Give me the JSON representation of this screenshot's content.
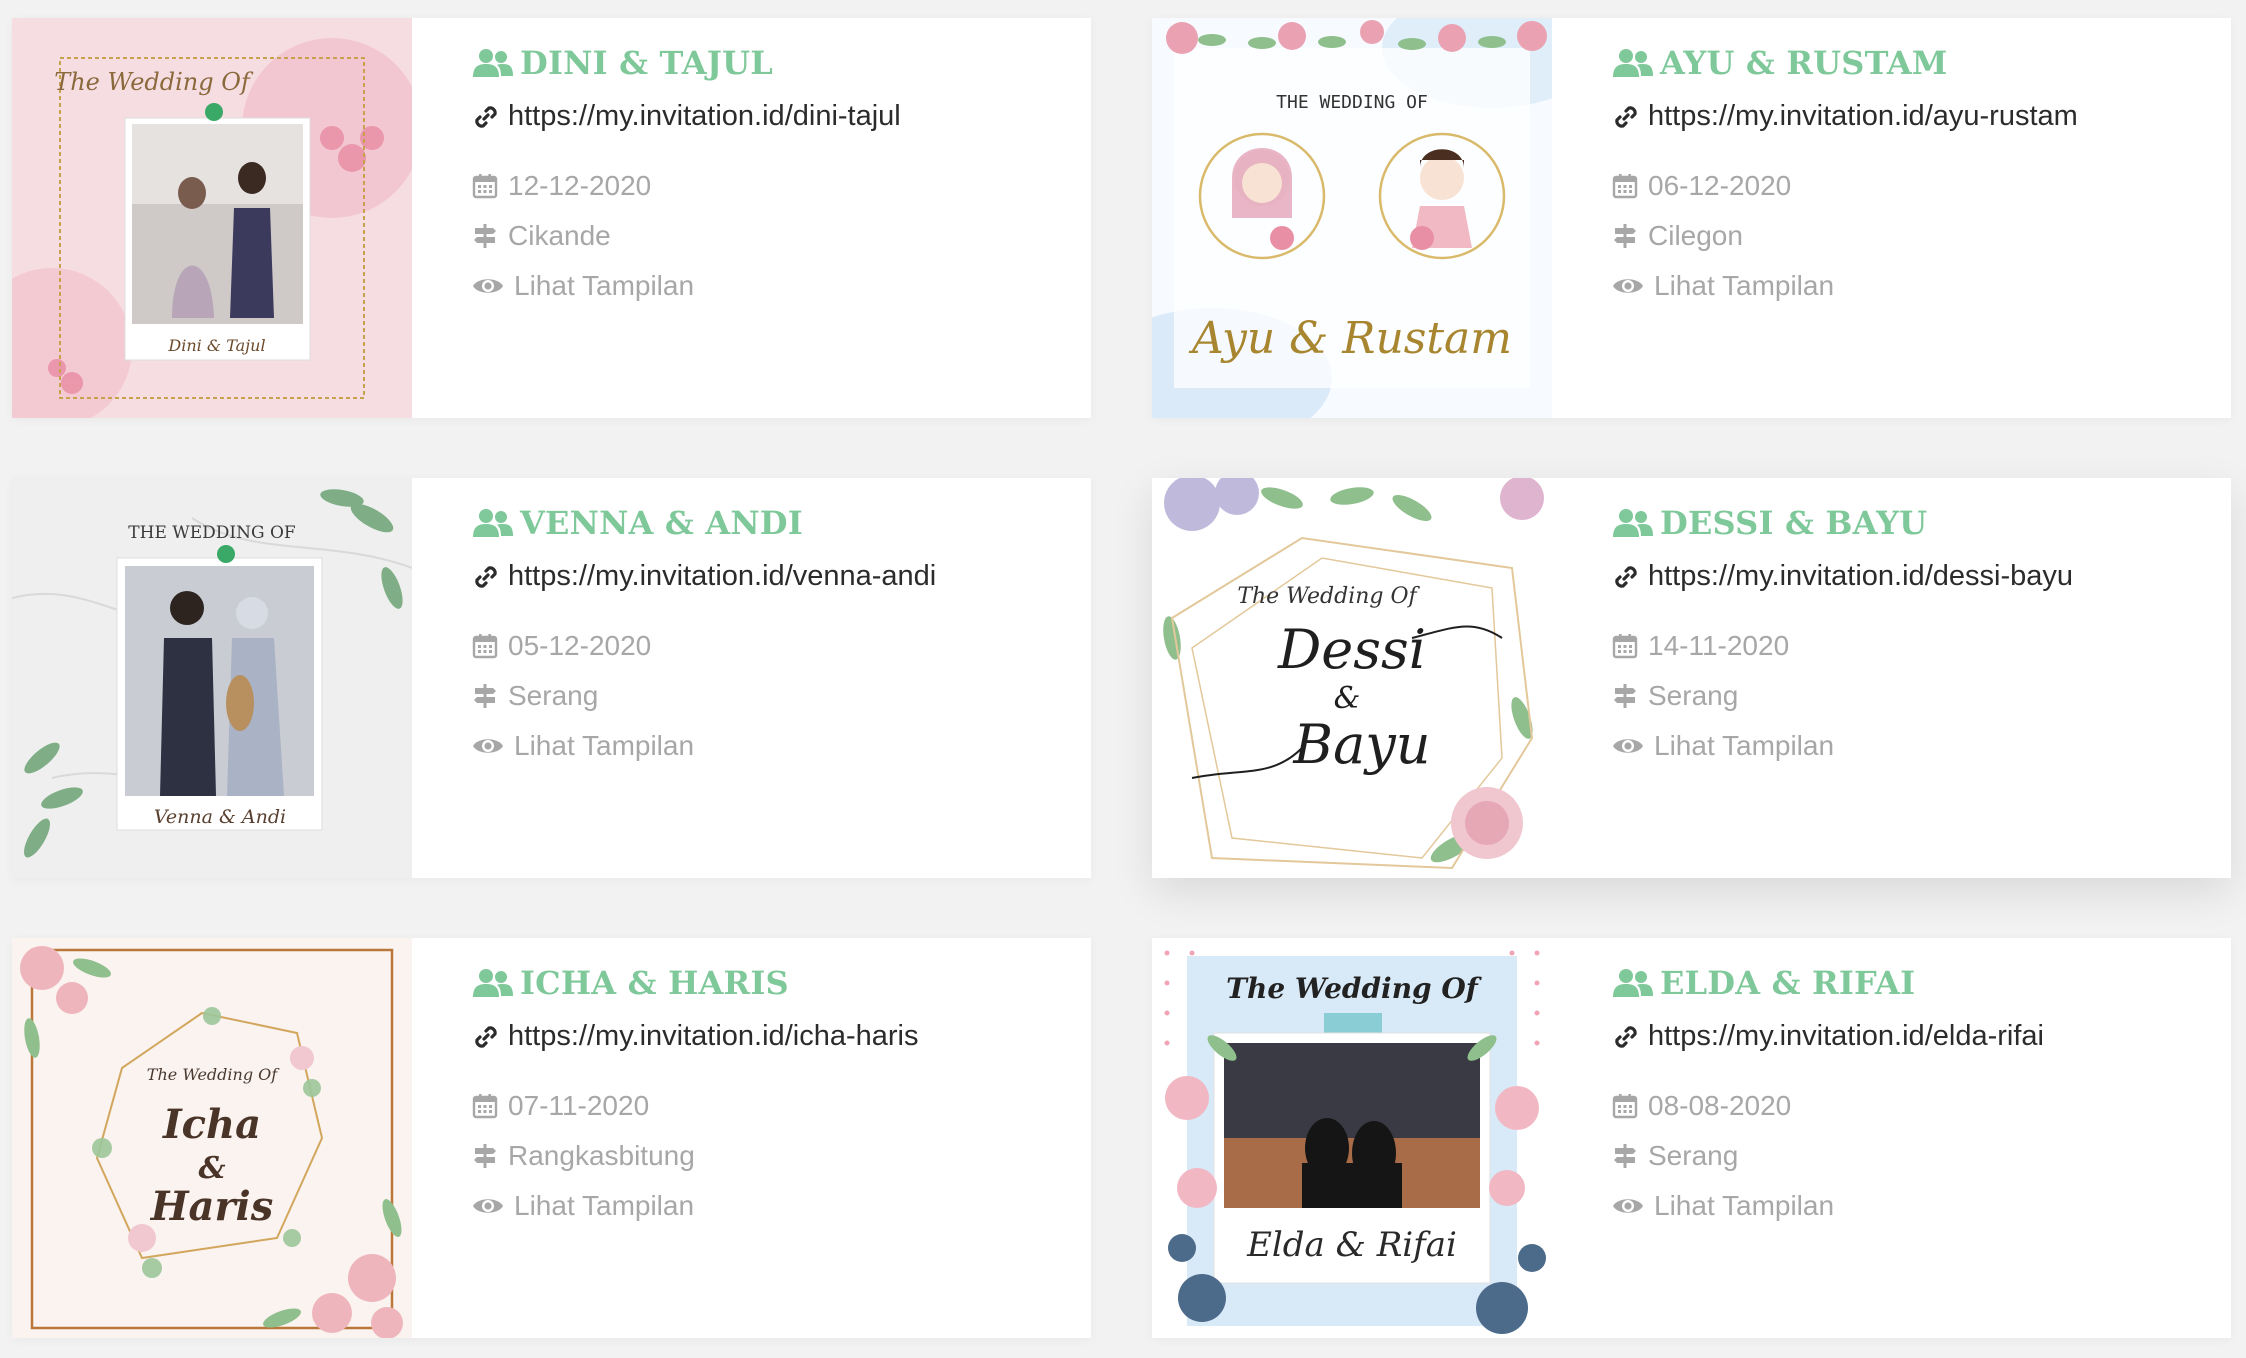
{
  "colors": {
    "accent": "#7ec89a",
    "link": "#2b2b2b",
    "muted": "#a7a7a7",
    "background": "#f2f2f2",
    "card": "#ffffff"
  },
  "icons": {
    "couple": "users-icon",
    "link": "link-icon",
    "date": "calendar-icon",
    "location": "signpost-icon",
    "view": "eye-icon"
  },
  "cards": [
    {
      "names": "DINI & TAJUL",
      "url": "https://my.invitation.id/dini-tajul",
      "date": "12-12-2020",
      "location": "Cikande",
      "view_label": "Lihat Tampilan",
      "thumb": {
        "heading": "The Wedding Of",
        "caption": "Dini & Tajul"
      }
    },
    {
      "names": "AYU & RUSTAM",
      "url": "https://my.invitation.id/ayu-rustam",
      "date": "06-12-2020",
      "location": "Cilegon",
      "view_label": "Lihat Tampilan",
      "thumb": {
        "heading": "THE WEDDING OF",
        "caption": "Ayu & Rustam"
      }
    },
    {
      "names": "VENNA & ANDI",
      "url": "https://my.invitation.id/venna-andi",
      "date": "05-12-2020",
      "location": "Serang",
      "view_label": "Lihat Tampilan",
      "thumb": {
        "heading": "THE WEDDING OF",
        "caption": "Venna & Andi"
      }
    },
    {
      "names": "DESSI & BAYU",
      "url": "https://my.invitation.id/dessi-bayu",
      "date": "14-11-2020",
      "location": "Serang",
      "view_label": "Lihat Tampilan",
      "thumb": {
        "heading": "The Wedding Of",
        "name1": "Dessi",
        "amp": "&",
        "name2": "Bayu"
      }
    },
    {
      "names": "ICHA & HARIS",
      "url": "https://my.invitation.id/icha-haris",
      "date": "07-11-2020",
      "location": "Rangkasbitung",
      "view_label": "Lihat Tampilan",
      "thumb": {
        "heading": "The Wedding Of",
        "name1": "Icha",
        "amp": "&",
        "name2": "Haris"
      }
    },
    {
      "names": "ELDA & RIFAI",
      "url": "https://my.invitation.id/elda-rifai",
      "date": "08-08-2020",
      "location": "Serang",
      "view_label": "Lihat Tampilan",
      "thumb": {
        "heading": "The Wedding Of",
        "caption": "Elda & Rifai"
      }
    }
  ]
}
